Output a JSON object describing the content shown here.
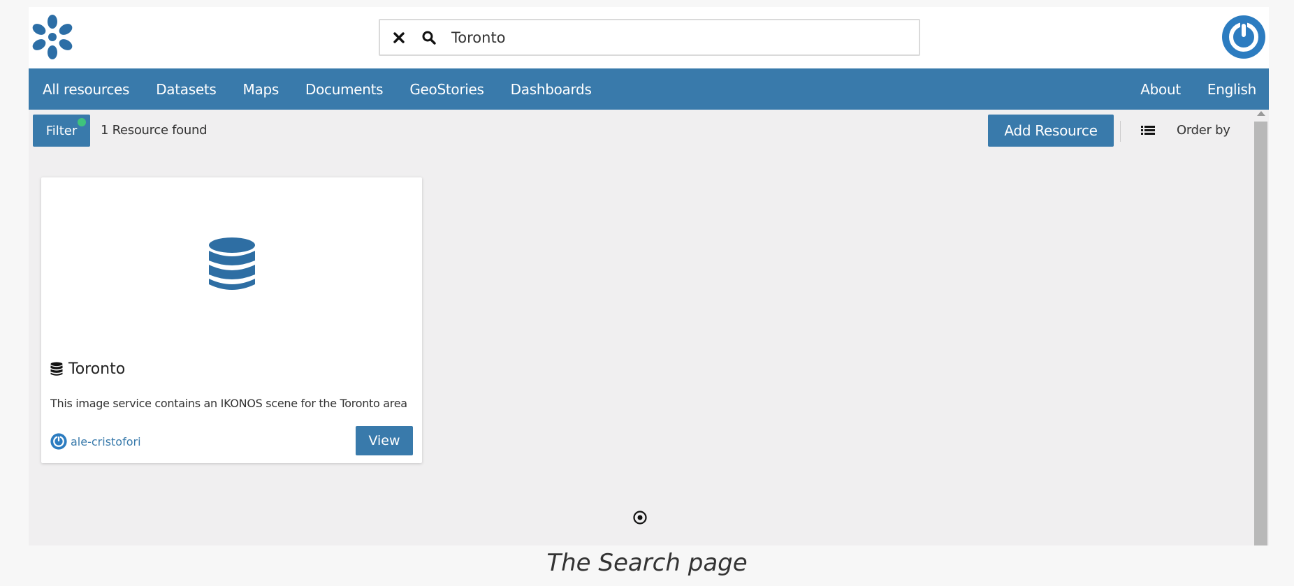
{
  "search": {
    "value": "Toronto",
    "placeholder": ""
  },
  "nav": {
    "items": [
      "All resources",
      "Datasets",
      "Maps",
      "Documents",
      "GeoStories",
      "Dashboards"
    ],
    "right": [
      "About",
      "English"
    ]
  },
  "toolbar": {
    "filter_label": "Filter",
    "result_count": "1 Resource found",
    "add_resource_label": "Add Resource",
    "order_by_label": "Order by"
  },
  "card": {
    "title": "Toronto",
    "description": "This image service contains an IKONOS scene for the Toronto area",
    "owner": "ale-cristofori",
    "view_label": "View",
    "type_icon": "database-icon"
  },
  "caption": "The Search page",
  "colors": {
    "primary": "#397aab",
    "filter_active_dot": "#3fc37c",
    "page_background": "#f0eff0"
  }
}
